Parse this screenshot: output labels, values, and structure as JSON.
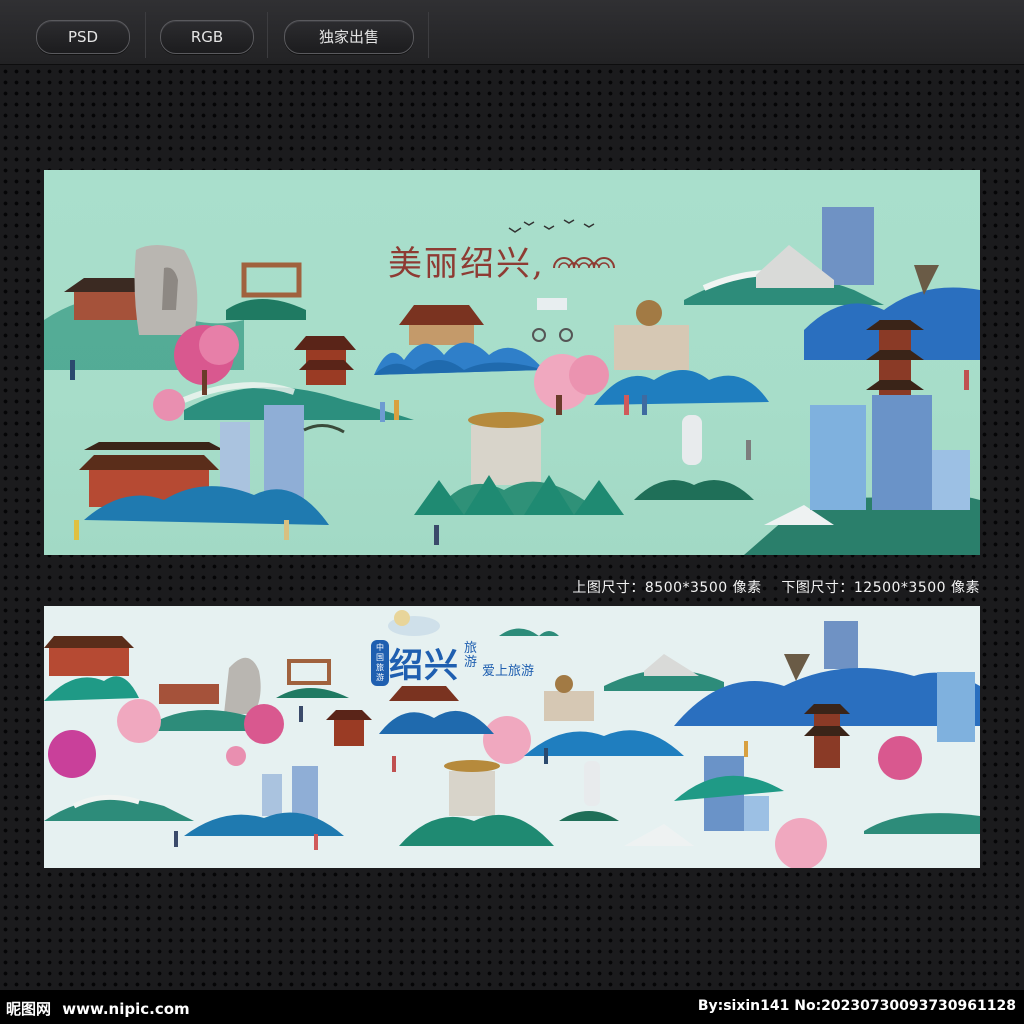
{
  "toolbar": {
    "tags": [
      "PSD",
      "RGB",
      "独家出售"
    ]
  },
  "top_design": {
    "title": "美丽绍兴,",
    "background": "#a9dfcc"
  },
  "bottom_design": {
    "badge": "中国旅游",
    "title": "绍兴",
    "title_side": "旅游",
    "slogan": "爱上旅游",
    "background": "#e6f1f1"
  },
  "caption": "上图尺寸：8500*3500 像素    下图尺寸：12500*3500 像素",
  "footer": {
    "brand": "昵图网",
    "site": "www.nipic.com",
    "credit": "By:sixin141 No:20230730093730961128"
  },
  "colors": {
    "tree_blue": "#2f7fc9",
    "tree_teal": "#1f9a86",
    "blossom": "#e98fb0",
    "roof": "#7a3320",
    "building": "#8fb7e0",
    "title_red": "#8e3b33",
    "title_blue": "#1f5fb0"
  }
}
